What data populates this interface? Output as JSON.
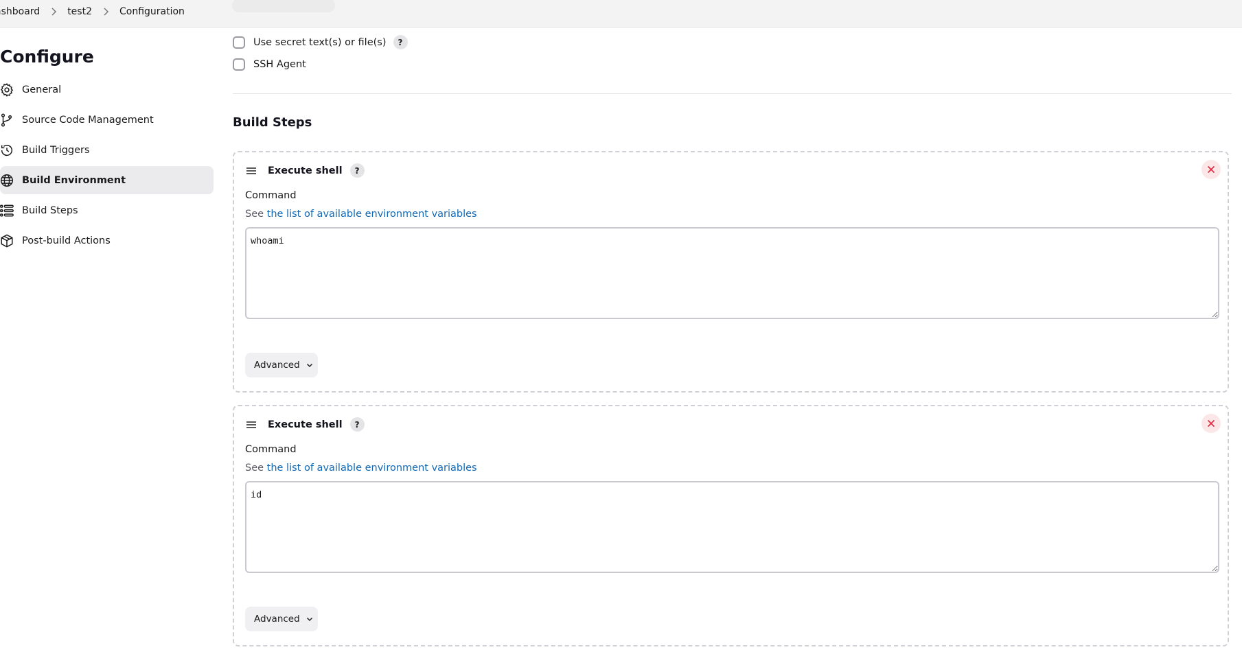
{
  "breadcrumb": {
    "items": [
      "ashboard",
      "test2",
      "Configuration"
    ]
  },
  "sidebar": {
    "title": "Configure",
    "items": [
      {
        "label": "General",
        "icon": "gear-icon"
      },
      {
        "label": "Source Code Management",
        "icon": "git-branch-icon"
      },
      {
        "label": "Build Triggers",
        "icon": "clock-icon"
      },
      {
        "label": "Build Environment",
        "icon": "globe-icon",
        "active": true
      },
      {
        "label": "Build Steps",
        "icon": "list-icon"
      },
      {
        "label": "Post-build Actions",
        "icon": "package-icon"
      }
    ]
  },
  "build_env": {
    "options": [
      {
        "label": "Use secret text(s) or file(s)",
        "checked": false,
        "help": "?"
      },
      {
        "label": "SSH Agent",
        "checked": false
      }
    ]
  },
  "build_steps": {
    "title": "Build Steps",
    "steps": [
      {
        "title": "Execute shell",
        "help": "?",
        "command_label": "Command",
        "desc_prefix": "See",
        "desc_link": "the list of available environment variables",
        "command": "whoami",
        "advanced_label": "Advanced"
      },
      {
        "title": "Execute shell",
        "help": "?",
        "command_label": "Command",
        "desc_prefix": "See",
        "desc_link": "the list of available environment variables",
        "command": "id",
        "advanced_label": "Advanced"
      }
    ]
  },
  "colors": {
    "link": "#1268b3",
    "close": "#e02a3f",
    "active_bg": "#ebebee"
  }
}
